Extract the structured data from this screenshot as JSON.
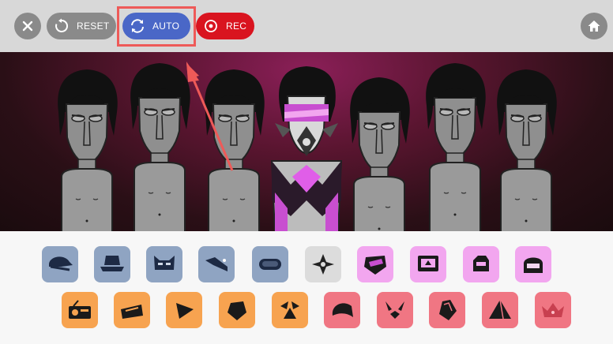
{
  "toolbar": {
    "reset_label": "RESET",
    "auto_label": "AUTO",
    "rec_label": "REC",
    "close_icon": "close-icon",
    "reset_icon": "reset-icon",
    "auto_icon": "refresh-icon",
    "rec_icon": "record-icon",
    "home_icon": "home-icon",
    "highlight_color": "#ee5a58"
  },
  "stage": {
    "characters": [
      {
        "name": "character-1",
        "style": "default"
      },
      {
        "name": "character-2",
        "style": "default"
      },
      {
        "name": "character-3",
        "style": "default"
      },
      {
        "name": "character-4",
        "style": "costumed-pink"
      },
      {
        "name": "character-5",
        "style": "default"
      },
      {
        "name": "character-6",
        "style": "default"
      },
      {
        "name": "character-7",
        "style": "default"
      }
    ]
  },
  "sound_icons": {
    "row1": [
      {
        "color": "blue",
        "icon": "cap-icon"
      },
      {
        "color": "blue",
        "icon": "bucket-hat-icon"
      },
      {
        "color": "blue",
        "icon": "cat-mask-icon"
      },
      {
        "color": "blue",
        "icon": "visor-icon"
      },
      {
        "color": "blue",
        "icon": "goggles-icon"
      },
      {
        "color": "gray",
        "icon": "shuriken-icon"
      },
      {
        "color": "pink",
        "icon": "shield-mask-icon"
      },
      {
        "color": "pink",
        "icon": "tablet-icon"
      },
      {
        "color": "pink",
        "icon": "robot-head-icon"
      },
      {
        "color": "pink",
        "icon": "helmet-icon"
      }
    ],
    "row2": [
      {
        "color": "orange",
        "icon": "radio-icon"
      },
      {
        "color": "orange",
        "icon": "keyboard-icon"
      },
      {
        "color": "orange",
        "icon": "play-shape-icon"
      },
      {
        "color": "orange",
        "icon": "gem-icon"
      },
      {
        "color": "orange",
        "icon": "arrows-icon"
      },
      {
        "color": "red",
        "icon": "hood-icon"
      },
      {
        "color": "red",
        "icon": "horns-icon"
      },
      {
        "color": "red",
        "icon": "crystal-icon"
      },
      {
        "color": "red",
        "icon": "pyramid-icon"
      },
      {
        "color": "red",
        "icon": "crown-icon"
      }
    ]
  }
}
